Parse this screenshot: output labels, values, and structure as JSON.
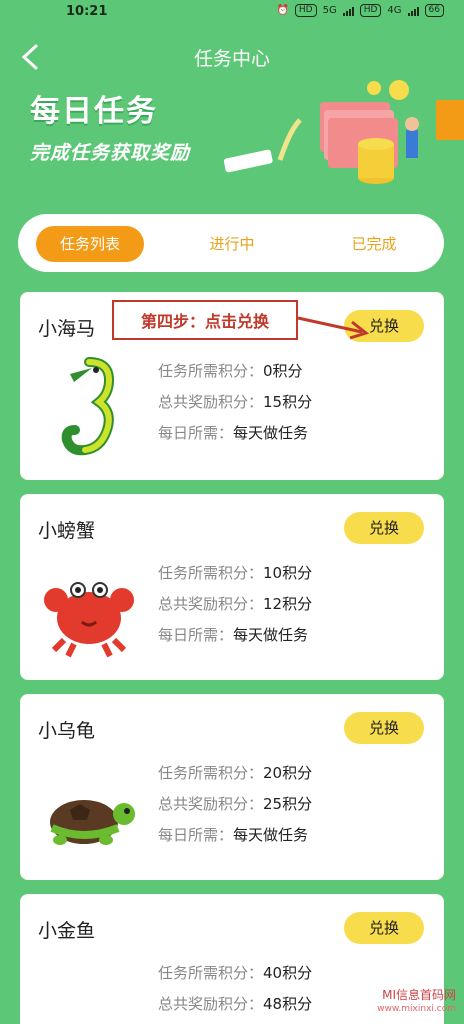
{
  "status": {
    "time": "10:21",
    "battery": "66",
    "net1": "5G",
    "net2": "4G",
    "hd": "HD"
  },
  "nav": {
    "title": "任务中心",
    "back": "<"
  },
  "banner": {
    "title": "每日任务",
    "subtitle": "完成任务获取奖励"
  },
  "tabs": [
    {
      "label": "任务列表"
    },
    {
      "label": "进行中"
    },
    {
      "label": "已完成"
    }
  ],
  "annotation": "第四步：点击兑换",
  "labels": {
    "need": "任务所需积分：",
    "reward": "总共奖励积分：",
    "daily": "每日所需：",
    "redeem": "兑换"
  },
  "tasks": [
    {
      "name": "小海马",
      "need": "0积分",
      "reward": "15积分",
      "daily": "每天做任务"
    },
    {
      "name": "小螃蟹",
      "need": "10积分",
      "reward": "12积分",
      "daily": "每天做任务"
    },
    {
      "name": "小乌龟",
      "need": "20积分",
      "reward": "25积分",
      "daily": "每天做任务"
    },
    {
      "name": "小金鱼",
      "need": "40积分",
      "reward": "48积分",
      "daily": ""
    }
  ],
  "watermark": {
    "brand": "MI信息首码网",
    "site": "www.mixinxi.com"
  },
  "colors": {
    "bg": "#5cc877",
    "accent": "#f39b17",
    "button": "#f7dc4c",
    "annotation": "#c0392b"
  }
}
